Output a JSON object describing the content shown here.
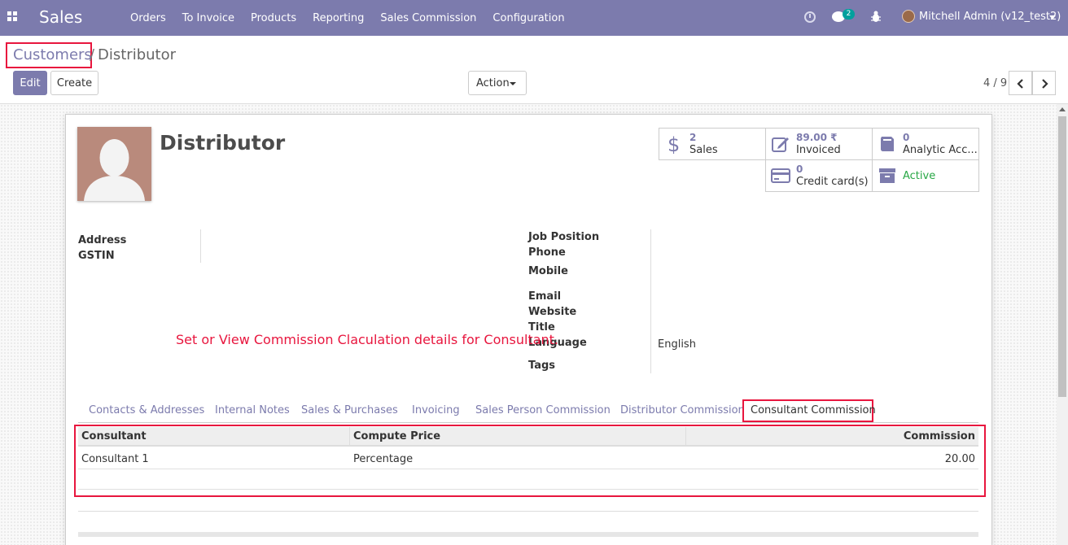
{
  "navbar": {
    "app_name": "Sales",
    "menu": [
      "Orders",
      "To Invoice",
      "Products",
      "Reporting",
      "Sales Commission",
      "Configuration"
    ],
    "chat_count": "2",
    "user": "Mitchell Admin (v12_test2)",
    "color": "#7c7bad"
  },
  "breadcrumb": {
    "parent": "Customers",
    "separator": "/",
    "current": "Distributor"
  },
  "buttons": {
    "edit": "Edit",
    "create": "Create",
    "action": "Action"
  },
  "pager": {
    "value": "4 / 9"
  },
  "record": {
    "name": "Distributor"
  },
  "smart_buttons": {
    "sales": {
      "value": "2",
      "label": "Sales"
    },
    "invoiced": {
      "value": "89.00 ₹",
      "label": "Invoiced"
    },
    "analytic": {
      "value": "0",
      "label": "Analytic Acc..."
    },
    "credit": {
      "value": "0",
      "label": "Credit card(s)"
    },
    "active": {
      "label": "Active"
    }
  },
  "fields_left": {
    "address": "Address",
    "gstin": "GSTIN"
  },
  "fields_right": {
    "job_position": "Job Position",
    "phone": "Phone",
    "mobile": "Mobile",
    "email": "Email",
    "website": "Website",
    "title": "Title",
    "language": "Language",
    "language_value": "English",
    "tags": "Tags"
  },
  "annotation": "Set or View Commission Claculation details for Consultant.",
  "tabs": [
    "Contacts & Addresses",
    "Internal Notes",
    "Sales & Purchases",
    "Invoicing",
    "Sales Person Commission",
    "Distributor Commission",
    "Consultant Commission"
  ],
  "table": {
    "headers": {
      "consultant": "Consultant",
      "compute_price": "Compute Price",
      "commission": "Commission"
    },
    "rows": [
      {
        "consultant": "Consultant 1",
        "compute_price": "Percentage",
        "commission": "20.00"
      }
    ]
  },
  "colors": {
    "accent": "#7c7bad",
    "highlight": "#e8163e",
    "active": "#28a745"
  }
}
